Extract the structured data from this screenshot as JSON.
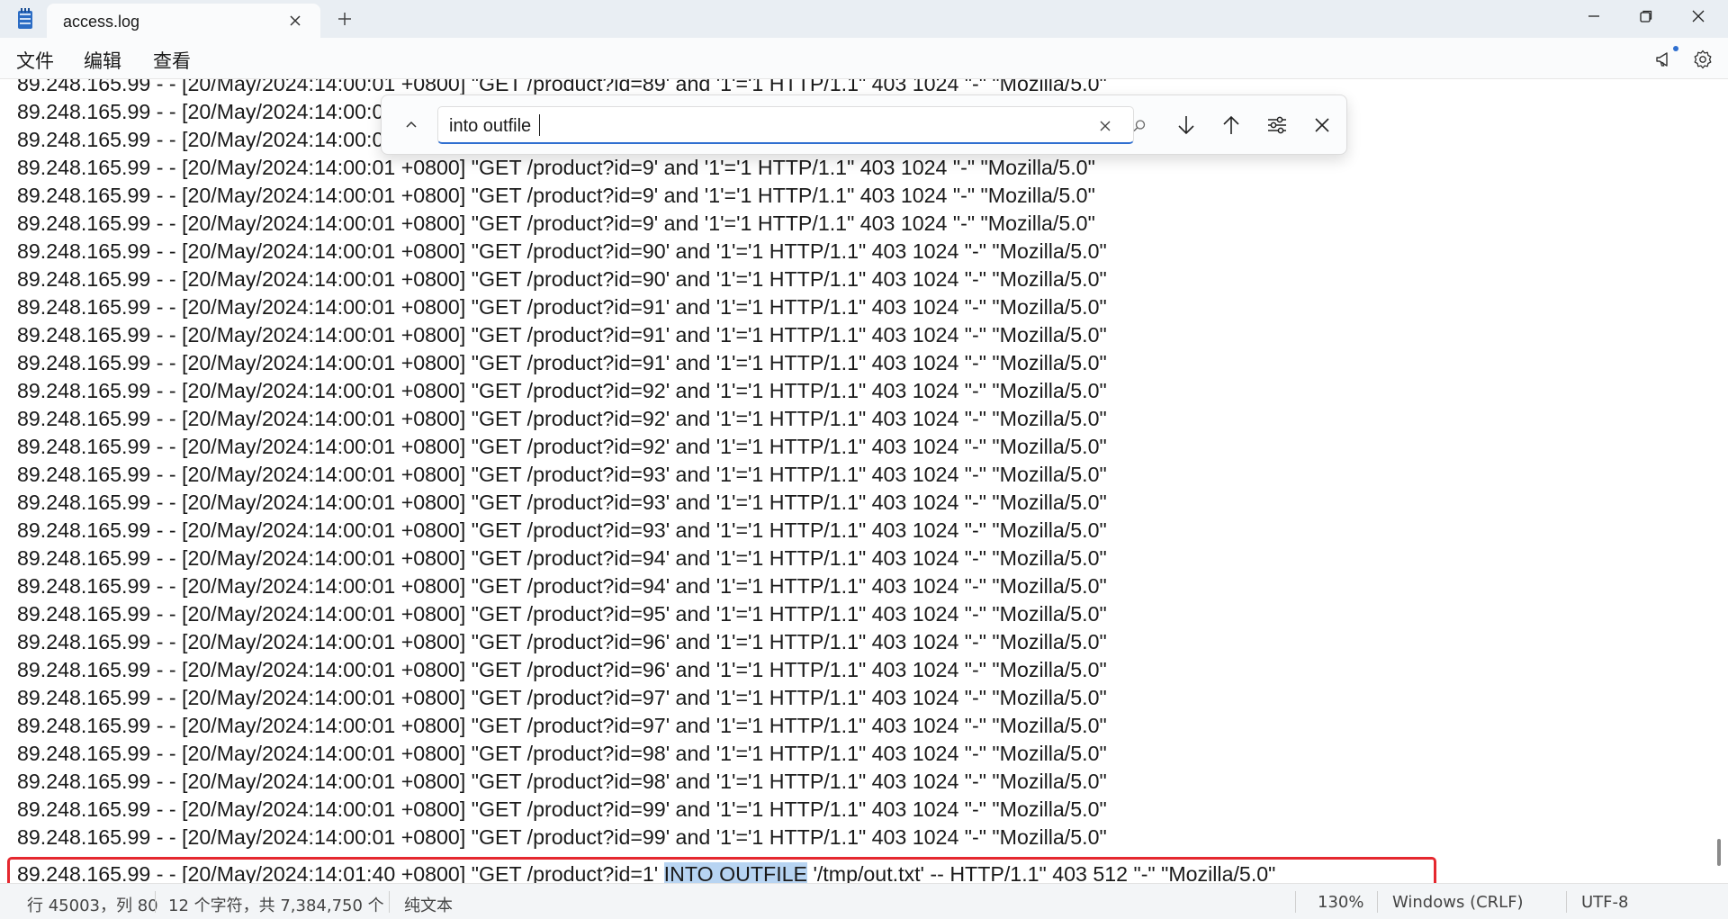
{
  "tab": {
    "title": "access.log"
  },
  "menu": {
    "file": "文件",
    "edit": "编辑",
    "view": "查看"
  },
  "find": {
    "query": "into outfile"
  },
  "log_lines": [
    "89.248.165.99 - - [20/May/2024:14:00:01 +0800] \"GET /product?id=89' and '1'='1 HTTP/1.1\" 403 1024 \"-\" \"Mozilla/5.0\"",
    "89.248.165.99 - - [20/May/2024:14:00:01 +0800] \"GET /product?id=9' and '1'='1 HTTP/1.1\" 403 1024 \"-\" \"Mozilla/5.0\"",
    "89.248.165.99 - - [20/May/2024:14:00:01 +0800] \"GET /product?id=9' and '1'='1 HTTP/1.1\" 403 1024 \"-\" \"Mozilla/5.0\"",
    "89.248.165.99 - - [20/May/2024:14:00:01 +0800] \"GET /product?id=9' and '1'='1 HTTP/1.1\" 403 1024 \"-\" \"Mozilla/5.0\"",
    "89.248.165.99 - - [20/May/2024:14:00:01 +0800] \"GET /product?id=9' and '1'='1 HTTP/1.1\" 403 1024 \"-\" \"Mozilla/5.0\"",
    "89.248.165.99 - - [20/May/2024:14:00:01 +0800] \"GET /product?id=9' and '1'='1 HTTP/1.1\" 403 1024 \"-\" \"Mozilla/5.0\"",
    "89.248.165.99 - - [20/May/2024:14:00:01 +0800] \"GET /product?id=90' and '1'='1 HTTP/1.1\" 403 1024 \"-\" \"Mozilla/5.0\"",
    "89.248.165.99 - - [20/May/2024:14:00:01 +0800] \"GET /product?id=90' and '1'='1 HTTP/1.1\" 403 1024 \"-\" \"Mozilla/5.0\"",
    "89.248.165.99 - - [20/May/2024:14:00:01 +0800] \"GET /product?id=91' and '1'='1 HTTP/1.1\" 403 1024 \"-\" \"Mozilla/5.0\"",
    "89.248.165.99 - - [20/May/2024:14:00:01 +0800] \"GET /product?id=91' and '1'='1 HTTP/1.1\" 403 1024 \"-\" \"Mozilla/5.0\"",
    "89.248.165.99 - - [20/May/2024:14:00:01 +0800] \"GET /product?id=91' and '1'='1 HTTP/1.1\" 403 1024 \"-\" \"Mozilla/5.0\"",
    "89.248.165.99 - - [20/May/2024:14:00:01 +0800] \"GET /product?id=92' and '1'='1 HTTP/1.1\" 403 1024 \"-\" \"Mozilla/5.0\"",
    "89.248.165.99 - - [20/May/2024:14:00:01 +0800] \"GET /product?id=92' and '1'='1 HTTP/1.1\" 403 1024 \"-\" \"Mozilla/5.0\"",
    "89.248.165.99 - - [20/May/2024:14:00:01 +0800] \"GET /product?id=92' and '1'='1 HTTP/1.1\" 403 1024 \"-\" \"Mozilla/5.0\"",
    "89.248.165.99 - - [20/May/2024:14:00:01 +0800] \"GET /product?id=93' and '1'='1 HTTP/1.1\" 403 1024 \"-\" \"Mozilla/5.0\"",
    "89.248.165.99 - - [20/May/2024:14:00:01 +0800] \"GET /product?id=93' and '1'='1 HTTP/1.1\" 403 1024 \"-\" \"Mozilla/5.0\"",
    "89.248.165.99 - - [20/May/2024:14:00:01 +0800] \"GET /product?id=93' and '1'='1 HTTP/1.1\" 403 1024 \"-\" \"Mozilla/5.0\"",
    "89.248.165.99 - - [20/May/2024:14:00:01 +0800] \"GET /product?id=94' and '1'='1 HTTP/1.1\" 403 1024 \"-\" \"Mozilla/5.0\"",
    "89.248.165.99 - - [20/May/2024:14:00:01 +0800] \"GET /product?id=94' and '1'='1 HTTP/1.1\" 403 1024 \"-\" \"Mozilla/5.0\"",
    "89.248.165.99 - - [20/May/2024:14:00:01 +0800] \"GET /product?id=95' and '1'='1 HTTP/1.1\" 403 1024 \"-\" \"Mozilla/5.0\"",
    "89.248.165.99 - - [20/May/2024:14:00:01 +0800] \"GET /product?id=96' and '1'='1 HTTP/1.1\" 403 1024 \"-\" \"Mozilla/5.0\"",
    "89.248.165.99 - - [20/May/2024:14:00:01 +0800] \"GET /product?id=96' and '1'='1 HTTP/1.1\" 403 1024 \"-\" \"Mozilla/5.0\"",
    "89.248.165.99 - - [20/May/2024:14:00:01 +0800] \"GET /product?id=97' and '1'='1 HTTP/1.1\" 403 1024 \"-\" \"Mozilla/5.0\"",
    "89.248.165.99 - - [20/May/2024:14:00:01 +0800] \"GET /product?id=97' and '1'='1 HTTP/1.1\" 403 1024 \"-\" \"Mozilla/5.0\"",
    "89.248.165.99 - - [20/May/2024:14:00:01 +0800] \"GET /product?id=98' and '1'='1 HTTP/1.1\" 403 1024 \"-\" \"Mozilla/5.0\"",
    "89.248.165.99 - - [20/May/2024:14:00:01 +0800] \"GET /product?id=98' and '1'='1 HTTP/1.1\" 403 1024 \"-\" \"Mozilla/5.0\"",
    "89.248.165.99 - - [20/May/2024:14:00:01 +0800] \"GET /product?id=99' and '1'='1 HTTP/1.1\" 403 1024 \"-\" \"Mozilla/5.0\"",
    "89.248.165.99 - - [20/May/2024:14:00:01 +0800] \"GET /product?id=99' and '1'='1 HTTP/1.1\" 403 1024 \"-\" \"Mozilla/5.0\""
  ],
  "last_line": {
    "before": "89.248.165.99 - - [20/May/2024:14:01:40 +0800] \"GET /product?id=1' ",
    "match": "INTO OUTFILE",
    "after": " '/tmp/out.txt' -- HTTP/1.1\" 403 512 \"-\" \"Mozilla/5.0\""
  },
  "status": {
    "position": "行 45003，列 80",
    "char_count": "12 个字符，共 7,384,750 个",
    "mode": "纯文本",
    "zoom": "130%",
    "line_ending": "Windows (CRLF)",
    "encoding": "UTF-8"
  },
  "colors": {
    "accent": "#2f6fd0",
    "match_highlight": "#b7d4f2",
    "annotation_border": "#e5282f"
  },
  "icons": {
    "app": "notepad-icon",
    "tab_close": "close-icon",
    "new_tab": "plus-icon",
    "minimize": "minimize-icon",
    "maximize": "restore-icon",
    "close": "close-icon",
    "announce": "megaphone-icon",
    "settings": "gear-icon",
    "find_toggle": "chevron-up-icon",
    "find_clear": "close-icon",
    "find_search": "search-icon",
    "find_next": "arrow-down-icon",
    "find_prev": "arrow-up-icon",
    "find_options": "sliders-icon",
    "find_close": "close-icon"
  }
}
